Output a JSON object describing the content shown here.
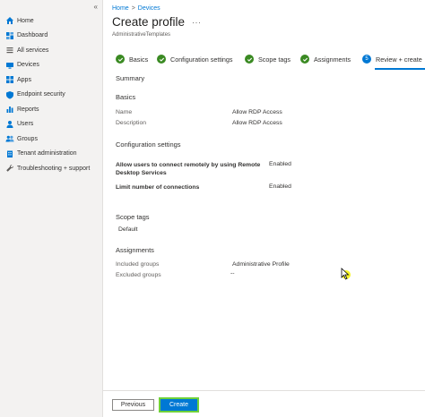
{
  "sidebar": {
    "collapse_label": "«",
    "items": [
      {
        "label": "Home",
        "icon": "home-icon"
      },
      {
        "label": "Dashboard",
        "icon": "dashboard-icon"
      },
      {
        "label": "All services",
        "icon": "all-services-icon"
      },
      {
        "label": "Devices",
        "icon": "devices-icon"
      },
      {
        "label": "Apps",
        "icon": "apps-icon"
      },
      {
        "label": "Endpoint security",
        "icon": "endpoint-security-icon"
      },
      {
        "label": "Reports",
        "icon": "reports-icon"
      },
      {
        "label": "Users",
        "icon": "users-icon"
      },
      {
        "label": "Groups",
        "icon": "groups-icon"
      },
      {
        "label": "Tenant administration",
        "icon": "tenant-admin-icon"
      },
      {
        "label": "Troubleshooting + support",
        "icon": "troubleshooting-icon"
      }
    ]
  },
  "header": {
    "breadcrumb": [
      "Home",
      "Devices"
    ],
    "breadcrumb_sep": ">",
    "title": "Create profile",
    "more": "···",
    "subtitle": "AdministrativeTemplates"
  },
  "steps": [
    {
      "label": "Basics",
      "state": "done"
    },
    {
      "label": "Configuration settings",
      "state": "done"
    },
    {
      "label": "Scope tags",
      "state": "done"
    },
    {
      "label": "Assignments",
      "state": "done"
    },
    {
      "label": "Review + create",
      "state": "current",
      "number": "5"
    }
  ],
  "review": {
    "summary_heading": "Summary",
    "basics": {
      "heading": "Basics",
      "name_label": "Name",
      "name_value": "Allow RDP Access",
      "description_label": "Description",
      "description_value": "Allow RDP Access"
    },
    "configuration": {
      "heading": "Configuration settings",
      "settings": [
        {
          "name_line1": "Allow users to connect remotely by using Remote",
          "name_line2": "Desktop Services",
          "value": "Enabled"
        },
        {
          "name_line1": "Limit number of connections",
          "name_line2": "",
          "value": "Enabled"
        }
      ]
    },
    "scope_tags": {
      "heading": "Scope tags",
      "value": "Default"
    },
    "assignments": {
      "heading": "Assignments",
      "included_label": "Included groups",
      "included_value": "Administrative Profile",
      "excluded_label": "Excluded groups",
      "excluded_value": "--"
    }
  },
  "footer": {
    "previous_label": "Previous",
    "create_label": "Create"
  },
  "colors": {
    "accent": "#0078d4",
    "success": "#3a8a22",
    "highlight": "#6fd13a",
    "cursor_halo": "#f5f200"
  }
}
